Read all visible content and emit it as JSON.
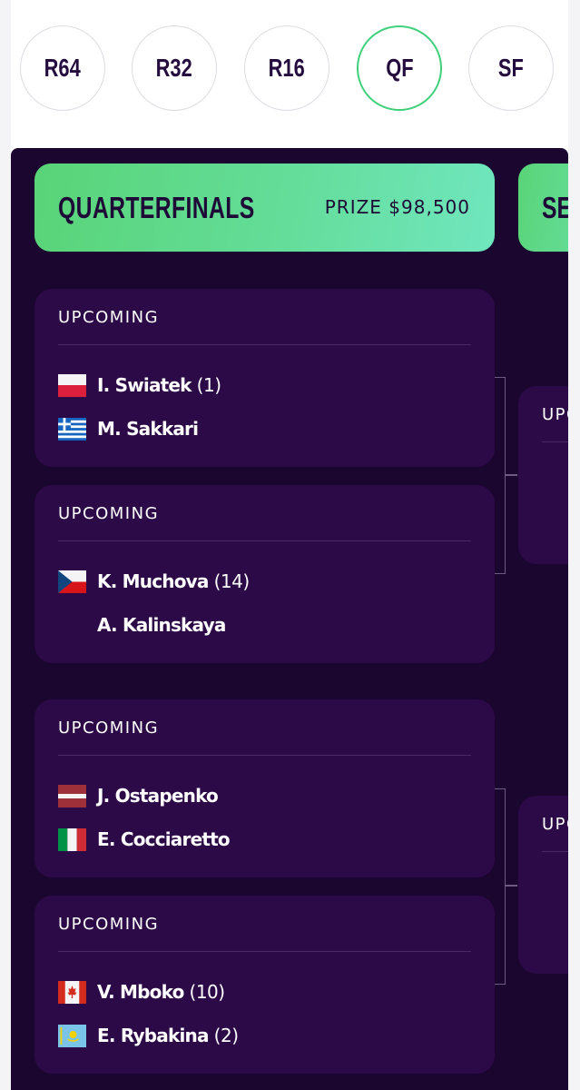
{
  "rounds": [
    {
      "label": "R64",
      "active": false
    },
    {
      "label": "R32",
      "active": false
    },
    {
      "label": "R16",
      "active": false
    },
    {
      "label": "QF",
      "active": true
    },
    {
      "label": "SF",
      "active": false
    }
  ],
  "current_round": {
    "title": "QUARTERFINALS",
    "prize": "PRIZE $98,500"
  },
  "next_round": {
    "title_partial": "SEI",
    "status_partial": "UPC"
  },
  "matches": [
    {
      "status": "UPCOMING",
      "players": [
        {
          "name": "I. Swiatek",
          "seed": "(1)",
          "flag": "flag-poland-icon"
        },
        {
          "name": "M. Sakkari",
          "seed": "",
          "flag": "flag-greece-icon"
        }
      ]
    },
    {
      "status": "UPCOMING",
      "players": [
        {
          "name": "K. Muchova",
          "seed": "(14)",
          "flag": "flag-czechia-icon"
        },
        {
          "name": "A. Kalinskaya",
          "seed": "",
          "flag": ""
        }
      ]
    },
    {
      "status": "UPCOMING",
      "players": [
        {
          "name": "J. Ostapenko",
          "seed": "",
          "flag": "flag-latvia-icon"
        },
        {
          "name": "E. Cocciaretto",
          "seed": "",
          "flag": "flag-italy-icon"
        }
      ]
    },
    {
      "status": "UPCOMING",
      "players": [
        {
          "name": "V. Mboko",
          "seed": "(10)",
          "flag": "flag-canada-icon"
        },
        {
          "name": "E. Rybakina",
          "seed": "(2)",
          "flag": "flag-kazakhstan-icon"
        }
      ]
    }
  ],
  "colors": {
    "background": "#1b0630",
    "card": "#2c0a47",
    "accent_green": "#59d477",
    "active_ring": "#3fd07a",
    "text_dark": "#240d3e"
  }
}
